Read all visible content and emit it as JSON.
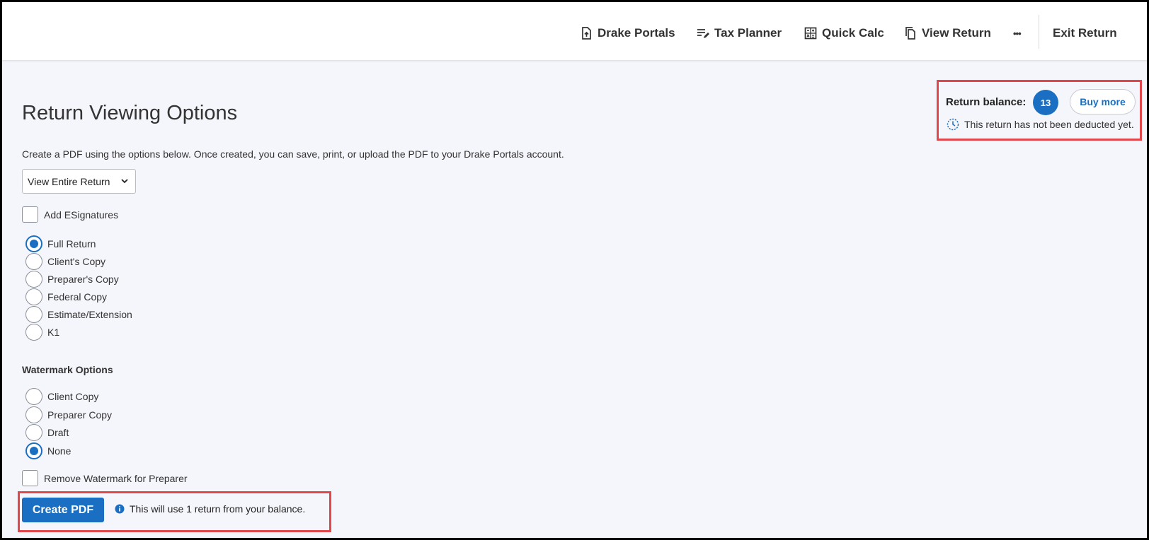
{
  "header": {
    "nav": [
      {
        "label": "Drake Portals",
        "icon": "upload-file-icon"
      },
      {
        "label": "Tax Planner",
        "icon": "edit-list-icon"
      },
      {
        "label": "Quick Calc",
        "icon": "calculator-icon"
      },
      {
        "label": "View Return",
        "icon": "copy-document-icon"
      }
    ],
    "more_label": "•••",
    "exit_label": "Exit Return"
  },
  "balance": {
    "label": "Return balance:",
    "count": "13",
    "buy_label": "Buy more",
    "note": "This return has not been deducted yet."
  },
  "main": {
    "title": "Return Viewing Options",
    "description": "Create a PDF using the options below. Once created, you can save, print, or upload the PDF to your Drake Portals account.",
    "view_select": "View Entire Return",
    "esignatures_label": "Add ESignatures",
    "copy_options": [
      {
        "label": "Full Return",
        "checked": true
      },
      {
        "label": "Client's Copy",
        "checked": false
      },
      {
        "label": "Preparer's Copy",
        "checked": false
      },
      {
        "label": "Federal Copy",
        "checked": false
      },
      {
        "label": "Estimate/Extension",
        "checked": false
      },
      {
        "label": "K1",
        "checked": false
      }
    ],
    "watermark_heading": "Watermark Options",
    "watermark_options": [
      {
        "label": "Client Copy",
        "checked": false
      },
      {
        "label": "Preparer Copy",
        "checked": false
      },
      {
        "label": "Draft",
        "checked": false
      },
      {
        "label": "None",
        "checked": true
      }
    ],
    "remove_watermark_label": "Remove Watermark for Preparer",
    "create_label": "Create PDF",
    "create_note": "This will use 1 return from your balance."
  },
  "colors": {
    "accent": "#1a6fc2",
    "highlight": "#e0464a"
  }
}
